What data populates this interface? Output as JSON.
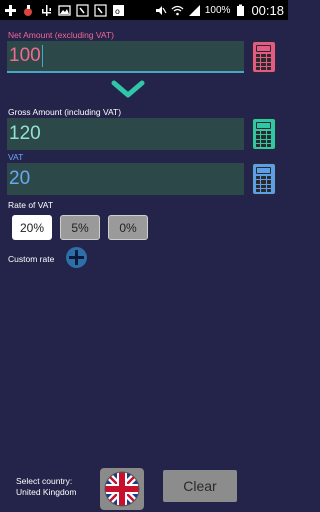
{
  "status_bar": {
    "battery_text": "100%",
    "time": "00:18"
  },
  "net": {
    "label": "Net Amount (excluding VAT)",
    "value": "100"
  },
  "gross": {
    "label": "Gross Amount (including VAT)",
    "value": "120"
  },
  "vat": {
    "label": "VAT",
    "value": "20"
  },
  "rate": {
    "label": "Rate of VAT",
    "options": [
      "20%",
      "5%",
      "0%"
    ],
    "selected": "20%"
  },
  "custom_rate": {
    "label": "Custom rate"
  },
  "country": {
    "label_line1": "Select country:",
    "label_line2": "United Kingdom"
  },
  "actions": {
    "clear_label": "Clear"
  },
  "colors": {
    "background": "#24234a",
    "net_accent": "#f06a92",
    "gross_accent": "#2fc7a8",
    "vat_accent": "#6aa8ef",
    "field_bg": "#2d4848"
  },
  "icons": {
    "net_calc": "calculator-icon",
    "gross_calc": "calculator-icon",
    "vat_calc": "calculator-icon",
    "direction": "chevron-down-icon",
    "custom_rate": "plus-circle-icon",
    "country_flag": "uk-flag-icon"
  }
}
